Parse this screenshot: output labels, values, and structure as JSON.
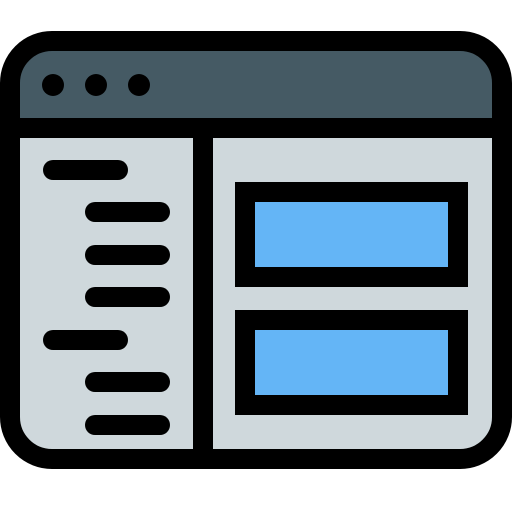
{
  "icon": {
    "name": "browser-window-sidebar-layout-icon",
    "colors": {
      "outline": "#000000",
      "titlebar": "#455A64",
      "panel": "#CFD8DC",
      "content_block": "#64B5F6",
      "background": "#FFFFFF"
    },
    "window_controls": [
      "dot",
      "dot",
      "dot"
    ],
    "sidebar": {
      "groups": [
        {
          "heading": "line",
          "items": [
            "line",
            "line",
            "line"
          ]
        },
        {
          "heading": "line",
          "items": [
            "line",
            "line"
          ]
        }
      ]
    },
    "main": {
      "content_blocks": [
        "block",
        "block"
      ]
    }
  }
}
